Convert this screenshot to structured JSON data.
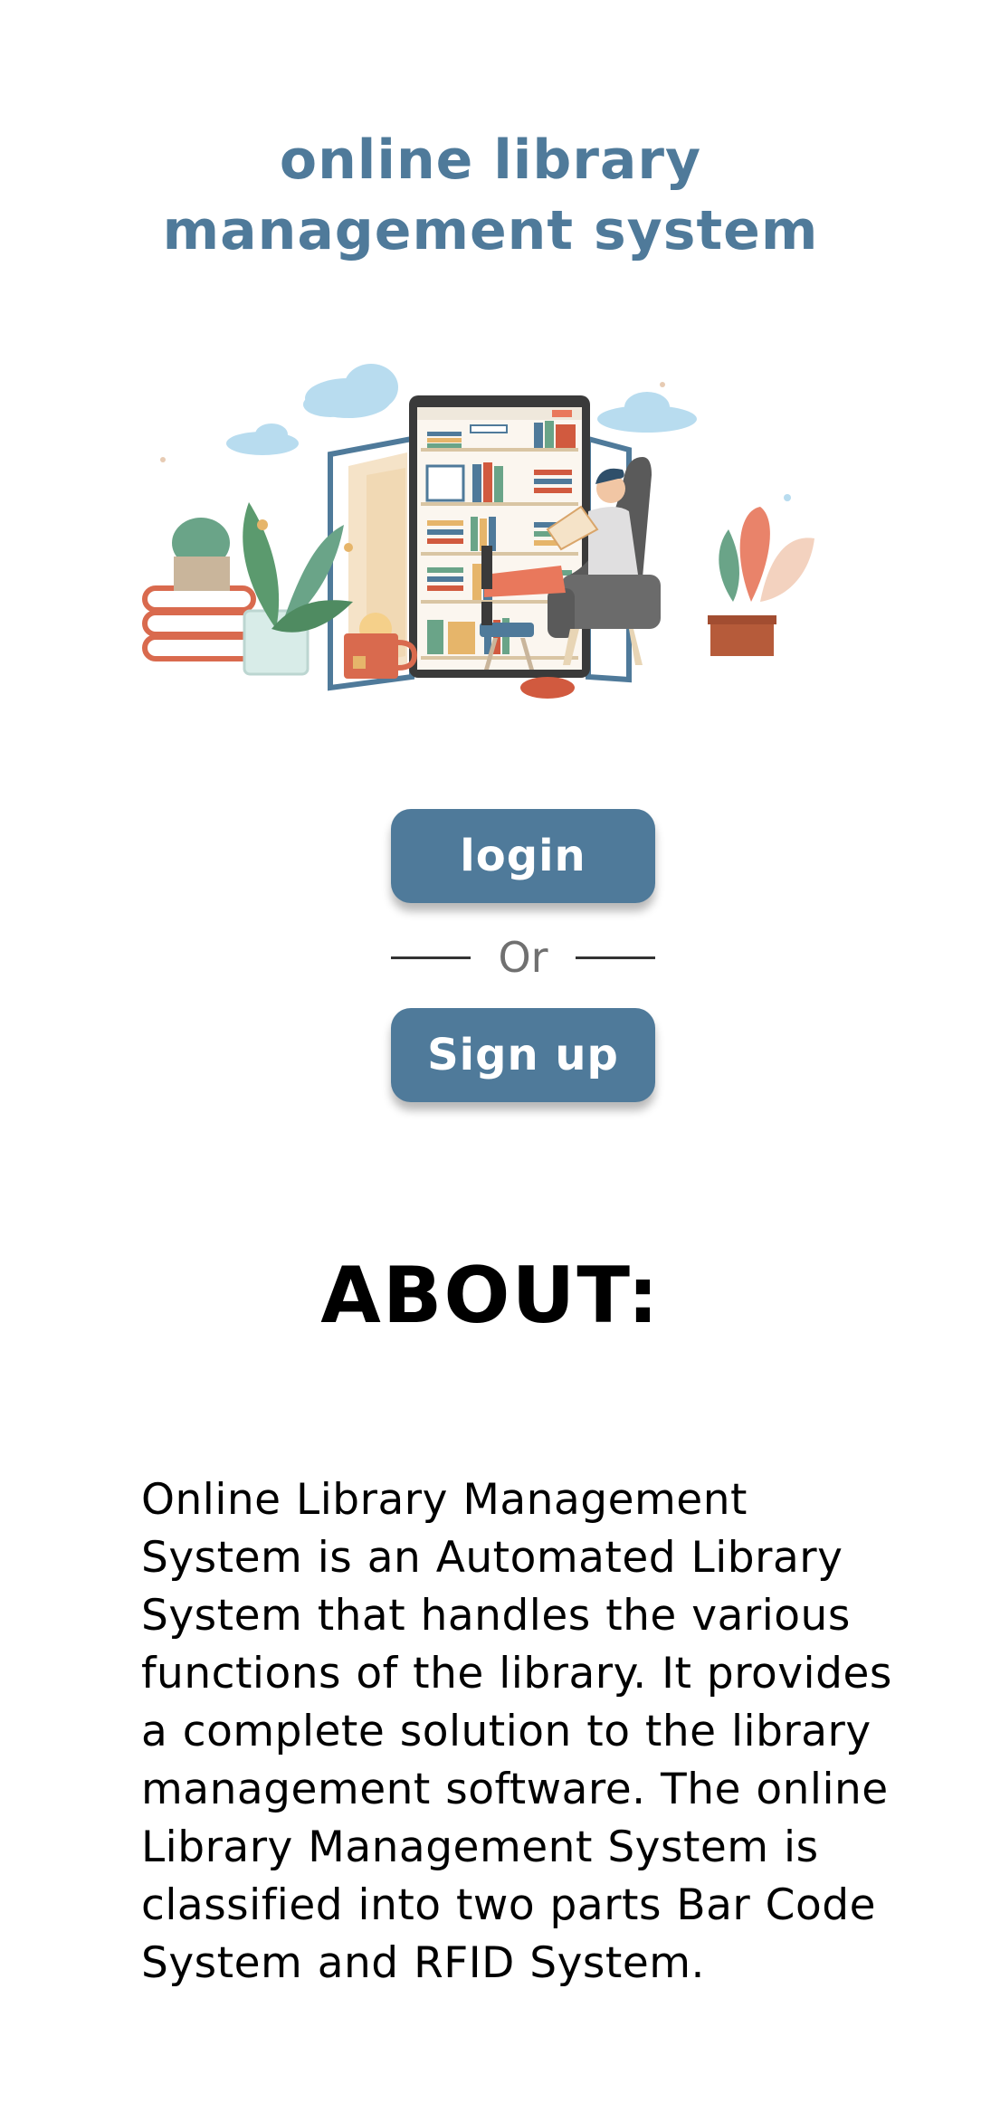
{
  "header": {
    "title_line1": "online library",
    "title_line2": "management system"
  },
  "hero": {
    "image": "library-illustration"
  },
  "auth": {
    "login_label": "login",
    "or_label": "Or",
    "signup_label": "Sign up"
  },
  "about": {
    "heading": "ABOUT:",
    "body": "Online Library Management System is an Automated Library System that handles the various functions of the library. It provides a complete solution to the library management software. The online Library Management System is classified into two parts Bar Code System and RFID System."
  },
  "colors": {
    "accent": "#4f7a9a",
    "text": "#000000",
    "muted": "#707070",
    "background": "#ffffff"
  }
}
